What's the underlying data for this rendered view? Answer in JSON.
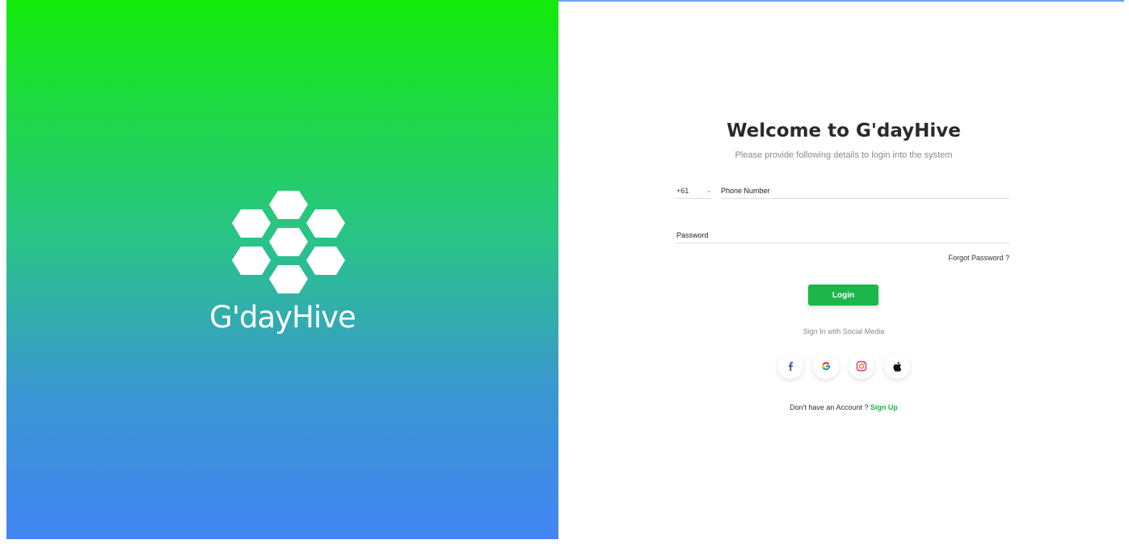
{
  "brand": {
    "logo_text": "G'dayHive",
    "logo_icon": "honeycomb-icon"
  },
  "login": {
    "welcome_prefix": "Welcome to ",
    "welcome_brand": "G'dayHive",
    "subtitle": "Please provide following details to login into the system",
    "country_code": "+61",
    "phone_placeholder": "Phone Number",
    "password_placeholder": "Password",
    "forgot_password": "Forgot Password ?",
    "login_button": "Login",
    "social_label": "Sign In with Social Media",
    "no_account_text": "Don't have an Account ? ",
    "signup_link": "Sign Up"
  },
  "social": [
    {
      "name": "facebook-icon"
    },
    {
      "name": "google-icon"
    },
    {
      "name": "instagram-icon"
    },
    {
      "name": "apple-icon"
    }
  ],
  "colors": {
    "gradient_top": "#13ea0a",
    "gradient_bottom": "#4285f4",
    "accent_green": "#1cb64a"
  }
}
